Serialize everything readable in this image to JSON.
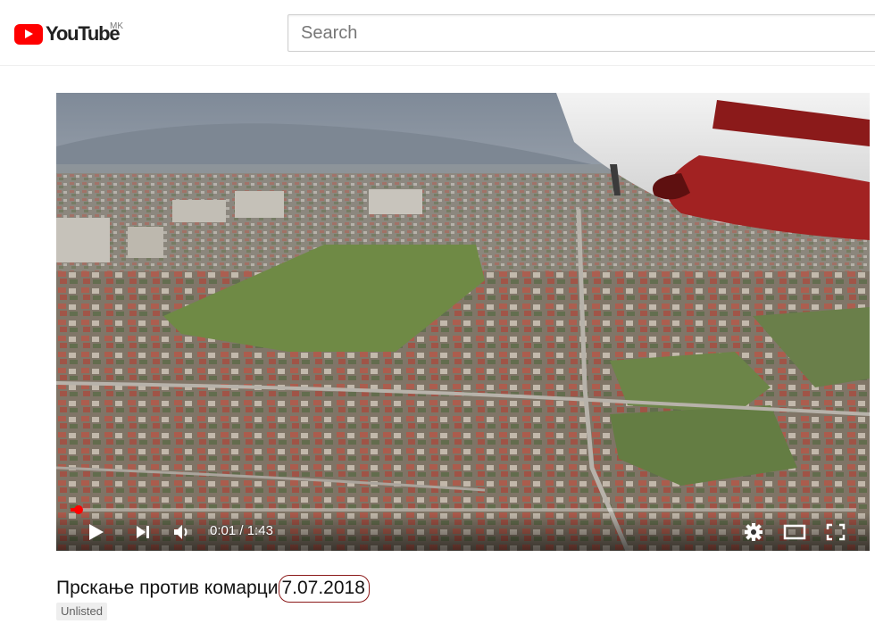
{
  "header": {
    "logo_text": "YouTube",
    "country_code": "MK",
    "search_placeholder": "Search"
  },
  "player": {
    "progress_fraction": 0.0097,
    "time_current": "0:01",
    "time_separator": " / ",
    "time_total": "1:43",
    "icons": [
      "play-icon",
      "next-icon",
      "volume-icon",
      "settings-icon",
      "theater-mode-icon",
      "fullscreen-icon"
    ]
  },
  "video": {
    "title": "Прскање против комарци ",
    "date": "7.07.2018",
    "visibility_badge": "Unlisted"
  },
  "colors": {
    "brand_red": "#ff0000",
    "date_outline": "#8b1a1a",
    "badge_bg": "#eeeeee"
  }
}
